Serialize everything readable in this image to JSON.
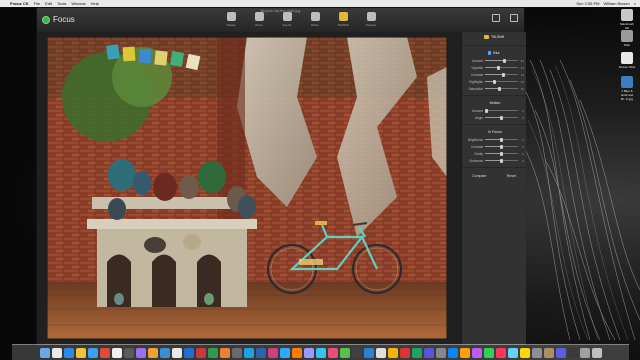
{
  "menubar": {
    "app_name": "Focus CK",
    "items": [
      "File",
      "Edit",
      "Tools",
      "Window",
      "Help"
    ],
    "clock": "Sun 2:55 PM",
    "user": "William Bowen"
  },
  "window": {
    "title": "Bicycle-by-the-wall.jpg",
    "app_logo": "Focus",
    "toolbar_tools": [
      {
        "icon": "rotate-icon",
        "label": "Rotate"
      },
      {
        "icon": "zoom-icon",
        "label": "Zoom"
      },
      {
        "icon": "export-icon",
        "label": "Export"
      },
      {
        "icon": "share-icon",
        "label": "Share"
      },
      {
        "icon": "tilt-shift-icon",
        "label": "Tilt-Shift"
      },
      {
        "icon": "presets-icon",
        "label": "Presets"
      }
    ],
    "active_tool": 4
  },
  "panel": {
    "title": "Tilt-Shift",
    "blur": {
      "label": "Blur",
      "rows": [
        {
          "label": "Amount",
          "value": "60",
          "level": 0.6
        },
        {
          "label": "Vignette",
          "value": "40",
          "level": 0.4
        },
        {
          "label": "Contrast",
          "value": "10",
          "level": 0.55
        },
        {
          "label": "Highlights",
          "value": "20",
          "level": 0.3
        },
        {
          "label": "Saturation",
          "value": "20",
          "level": 0.45
        }
      ]
    },
    "motion": {
      "label": "Motion",
      "rows": [
        {
          "label": "Amount",
          "value": "0",
          "level": 0.05
        },
        {
          "label": "Angle",
          "value": "0",
          "level": 0.5
        }
      ]
    },
    "in_focus": {
      "label": "In Focus",
      "rows": [
        {
          "label": "Brightness",
          "value": "0",
          "level": 0.5
        },
        {
          "label": "Contrast",
          "value": "0",
          "level": 0.5
        },
        {
          "label": "Clarity",
          "value": "0",
          "level": 0.5
        },
        {
          "label": "Vividness",
          "value": "0",
          "level": 0.5
        }
      ]
    },
    "compare_label": "Compare",
    "reset_label": "Reset"
  },
  "desktop_icons": [
    {
      "label": "Macintosh HD",
      "icon": "hard-drive-icon"
    },
    {
      "label": "Disk",
      "icon": "disk-icon"
    },
    {
      "label": "Screen Shot",
      "icon": "image-file-icon"
    },
    {
      "label": "1 Blue & Gold and Bl...K.jpg",
      "icon": "image-file-icon"
    }
  ],
  "dock": {
    "colors": [
      "#6aa9e8",
      "#e9e9e9",
      "#2a8ae6",
      "#f3c23c",
      "#3aa0f0",
      "#e04a3a",
      "#f0f0f0",
      "#5b5b5b",
      "#9c6ef0",
      "#f0a030",
      "#3b8fd8",
      "#e8e8e8",
      "#1f6fd0",
      "#c83a3a",
      "#2e9b4f",
      "#f08030",
      "#6a6a6a",
      "#1fa0e0",
      "#3060b0",
      "#d04080",
      "#31a8ff",
      "#ff7c00",
      "#9999ff",
      "#31c5f0",
      "#e94e77",
      "#5ac04a",
      "#404040",
      "#2f7ed8",
      "#e0e0e0",
      "#f7b500",
      "#d33",
      "#1ea362",
      "#5856d6",
      "#888",
      "#0a84ff",
      "#ff9f0a",
      "#bf5af2",
      "#30d158",
      "#ff375f",
      "#64d2ff",
      "#ffd60a",
      "#8e8e93",
      "#ac8e68",
      "#5e5ce6",
      "#3a3a3c",
      "#a0a0a0",
      "#c0c0c0"
    ]
  }
}
